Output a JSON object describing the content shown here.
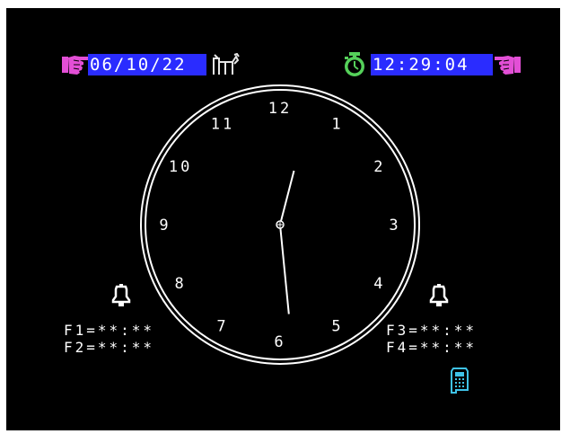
{
  "colors": {
    "background": "#000000",
    "frame": "#ffffff",
    "accent_blue": "#2a2cff",
    "hand_magenta": "#e34fd6",
    "timer_green": "#55d15a",
    "phone_cyan": "#3fc3e8",
    "text": "#ffffff"
  },
  "header": {
    "date": "06/10/22",
    "time": "12:29:04",
    "left_hand_icon": "pointing-hand-right-icon",
    "date_side_icon": "cat-icon",
    "timer_icon": "stopwatch-icon",
    "right_hand_icon": "pointing-hand-left-icon"
  },
  "clock": {
    "numerals": [
      "12",
      "1",
      "2",
      "3",
      "4",
      "5",
      "6",
      "7",
      "8",
      "9",
      "10",
      "11"
    ],
    "time": {
      "hours": 12,
      "minutes": 29,
      "seconds": 4
    }
  },
  "alarms": {
    "left_icon": "bell-icon",
    "right_icon": "bell-icon",
    "f1": "F1=**:**",
    "f2": "F2=**:**",
    "f3": "F3=**:**",
    "f4": "F4=**:**"
  },
  "footer": {
    "phone_icon": "telephone-icon"
  }
}
